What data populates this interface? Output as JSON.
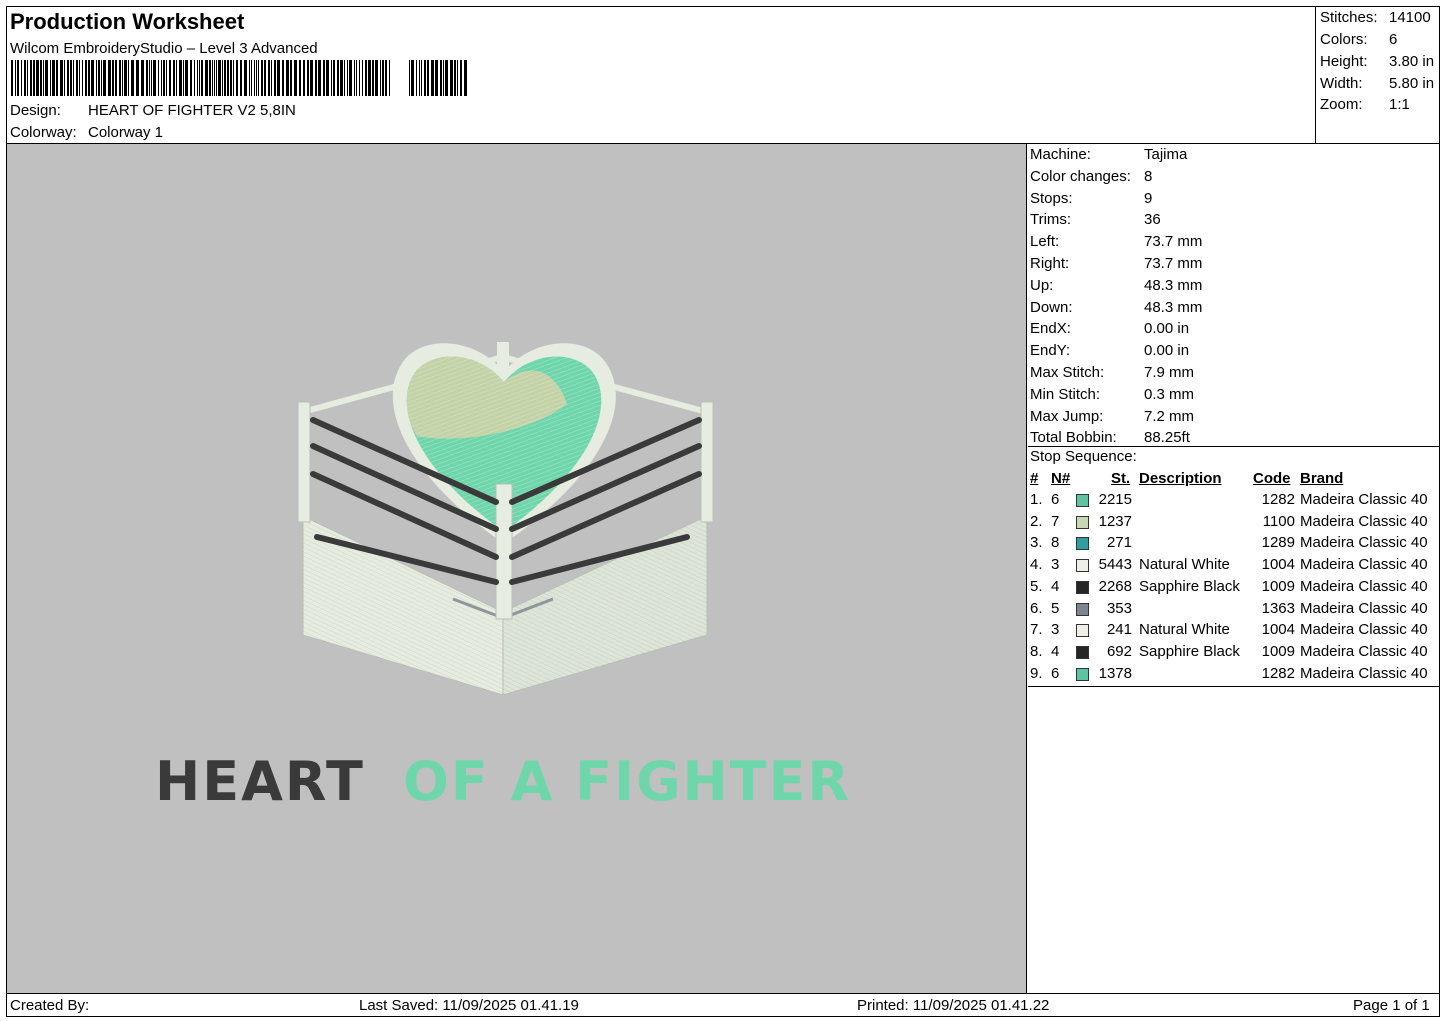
{
  "header": {
    "title": "Production Worksheet",
    "software": "Wilcom EmbroideryStudio – Level 3 Advanced",
    "design_label": "Design:",
    "design_value": "HEART OF FIGHTER V2 5,8IN",
    "colorway_label": "Colorway:",
    "colorway_value": "Colorway 1"
  },
  "summary": {
    "stitches_label": "Stitches:",
    "stitches_value": "14100",
    "colors_label": "Colors:",
    "colors_value": "6",
    "height_label": "Height:",
    "height_value": "3.80 in",
    "width_label": "Width:",
    "width_value": "5.80 in",
    "zoom_label": "Zoom:",
    "zoom_value": "1:1"
  },
  "machine_info": [
    {
      "label": "Machine:",
      "value": "Tajima"
    },
    {
      "label": "Color changes:",
      "value": "8"
    },
    {
      "label": "Stops:",
      "value": "9"
    },
    {
      "label": "Trims:",
      "value": "36"
    },
    {
      "label": "Left:",
      "value": "73.7 mm"
    },
    {
      "label": "Right:",
      "value": "73.7 mm"
    },
    {
      "label": "Up:",
      "value": "48.3 mm"
    },
    {
      "label": "Down:",
      "value": "48.3 mm"
    },
    {
      "label": "EndX:",
      "value": "0.00 in"
    },
    {
      "label": "EndY:",
      "value": "0.00 in"
    },
    {
      "label": "Max Stitch:",
      "value": "7.9 mm"
    },
    {
      "label": "Min Stitch:",
      "value": "0.3 mm"
    },
    {
      "label": "Max Jump:",
      "value": "7.2 mm"
    },
    {
      "label": "Total Bobbin:",
      "value": "88.25ft"
    }
  ],
  "stop_sequence": {
    "title": "Stop Sequence:",
    "columns": {
      "num": "#",
      "n": "N#",
      "st": "St.",
      "description": "Description",
      "code": "Code",
      "brand": "Brand"
    },
    "rows": [
      {
        "num": "1.",
        "n": "6",
        "color": "#5cc4a0",
        "st": "2215",
        "description": "",
        "code": "1282",
        "brand": "Madeira Classic 40"
      },
      {
        "num": "2.",
        "n": "7",
        "color": "#c9d8b4",
        "st": "1237",
        "description": "",
        "code": "1100",
        "brand": "Madeira Classic 40"
      },
      {
        "num": "3.",
        "n": "8",
        "color": "#2f9e9e",
        "st": "271",
        "description": "",
        "code": "1289",
        "brand": "Madeira Classic 40"
      },
      {
        "num": "4.",
        "n": "3",
        "color": "#efefe8",
        "st": "5443",
        "description": "Natural White",
        "code": "1004",
        "brand": "Madeira Classic 40"
      },
      {
        "num": "5.",
        "n": "4",
        "color": "#262626",
        "st": "2268",
        "description": "Sapphire Black",
        "code": "1009",
        "brand": "Madeira Classic 40"
      },
      {
        "num": "6.",
        "n": "5",
        "color": "#7d8590",
        "st": "353",
        "description": "",
        "code": "1363",
        "brand": "Madeira Classic 40"
      },
      {
        "num": "7.",
        "n": "3",
        "color": "#efefe8",
        "st": "241",
        "description": "Natural White",
        "code": "1004",
        "brand": "Madeira Classic 40"
      },
      {
        "num": "8.",
        "n": "4",
        "color": "#262626",
        "st": "692",
        "description": "Sapphire Black",
        "code": "1009",
        "brand": "Madeira Classic 40"
      },
      {
        "num": "9.",
        "n": "6",
        "color": "#5cc4a0",
        "st": "1378",
        "description": "",
        "code": "1282",
        "brand": "Madeira Classic 40"
      }
    ]
  },
  "preview": {
    "text_dark": "HEART",
    "text_green": "OF A FIGHTER",
    "colors": {
      "background": "#c0c0c0",
      "green": "#6fd6ac",
      "dark": "#3a3a3a",
      "ring": "#e6ece0",
      "heart_light": "#c4d2a8"
    }
  },
  "footer": {
    "created_by": "Created By:",
    "last_saved": "Last Saved: 11/09/2025 01.41.19",
    "printed": "Printed: 11/09/2025 01.41.22",
    "page": "Page 1 of 1"
  }
}
